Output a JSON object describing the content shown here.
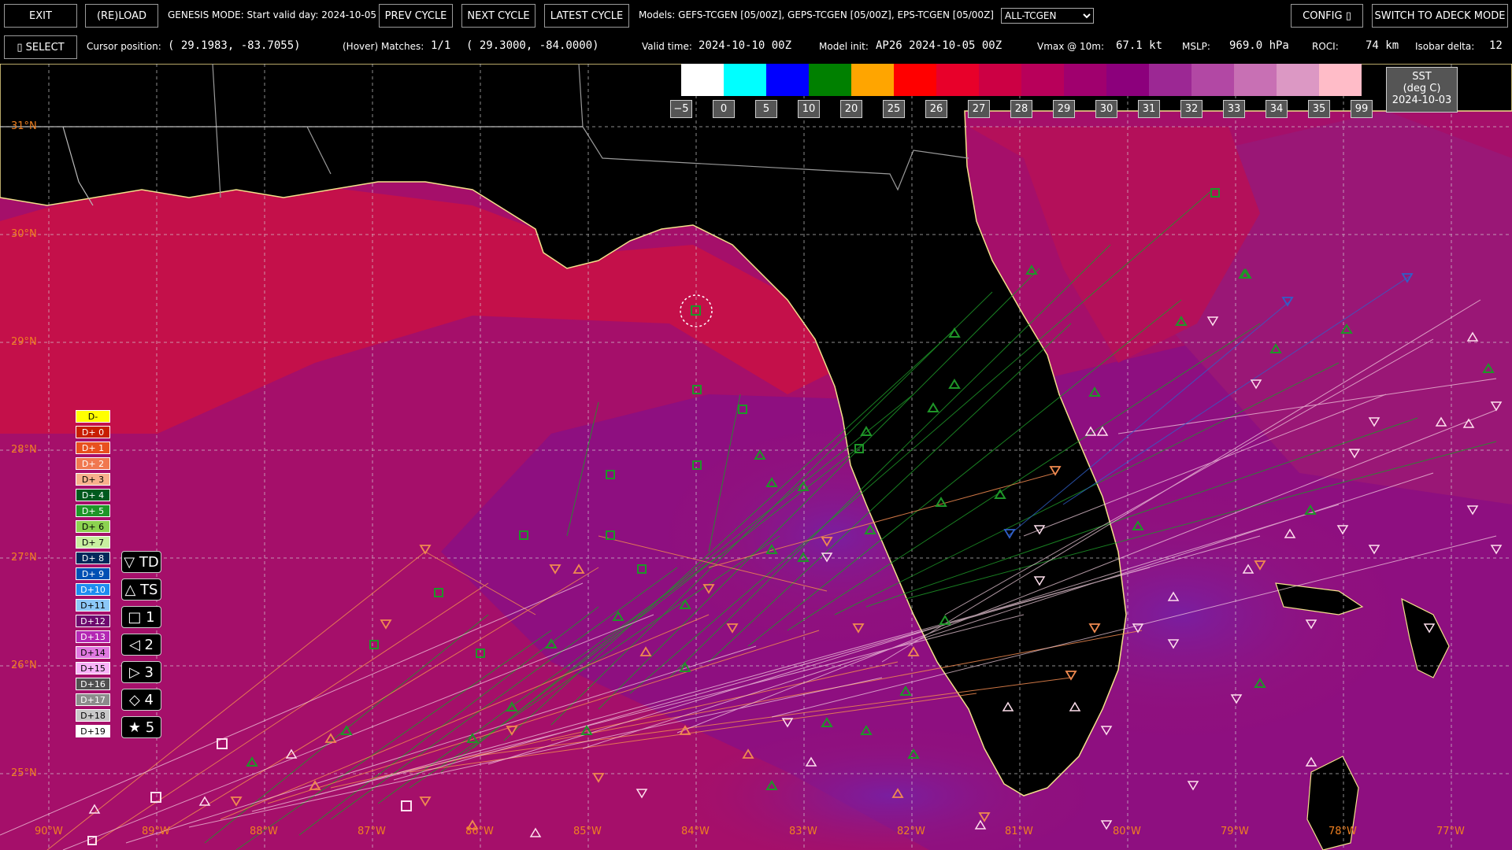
{
  "toolbar": {
    "exit_label": "EXIT",
    "reload_label": "(RE)LOAD",
    "genesis_text": "GENESIS MODE: Start valid day: 2024-10-05",
    "prev_cycle_label": "PREV CYCLE",
    "next_cycle_label": "NEXT CYCLE",
    "latest_cycle_label": "LATEST CYCLE",
    "models_text": "Models: GEFS-TCGEN [05/00Z], GEPS-TCGEN [05/00Z], EPS-TCGEN [05/00Z]",
    "model_select": "ALL-TCGEN",
    "config_label": "CONFIG ▯",
    "switch_label": "SWITCH TO ADECK MODE"
  },
  "status": {
    "select_label": "▯ SELECT",
    "cursor_label": "Cursor position:",
    "cursor_value": "( 29.1983,  -83.7055)",
    "hover_label": "(Hover) Matches:",
    "hover_count": "1/1",
    "hover_value": "( 29.3000,  -84.0000)",
    "valid_label": "Valid time:",
    "valid_value": "2024-10-10 00Z",
    "model_label": "Model init:",
    "model_value": "AP26 2024-10-05 00Z",
    "vmax_label": "Vmax @ 10m:",
    "vmax_value": "67.1 kt",
    "mslp_label": "MSLP:",
    "mslp_value": "969.0 hPa",
    "roci_label": "ROCI:",
    "roci_value": "74 km",
    "isobar_label": "Isobar delta:",
    "isobar_value": "12"
  },
  "colorbar": {
    "title_line1": "SST",
    "title_line2": "(deg C)",
    "title_line3": "2024-10-03",
    "colors": [
      "#ffffff",
      "#00ffff",
      "#0000ff",
      "#008000",
      "#ffa500",
      "#ff0000",
      "#e8002a",
      "#cc0044",
      "#b8005a",
      "#a0006e",
      "#8c007c",
      "#9c2894",
      "#b248a4",
      "#c870b4",
      "#dc98c4",
      "#ffbcc8"
    ],
    "ticks": [
      "−5",
      "0",
      "5",
      "10",
      "20",
      "25",
      "26",
      "27",
      "28",
      "29",
      "30",
      "31",
      "32",
      "33",
      "34",
      "35",
      "99"
    ]
  },
  "map": {
    "lat_labels": [
      "31°N",
      "30°N",
      "29°N",
      "28°N",
      "27°N",
      "26°N",
      "25°N"
    ],
    "lon_labels": [
      "90°W",
      "89°W",
      "88°W",
      "87°W",
      "86°W",
      "85°W",
      "84°W",
      "83°W",
      "82°W",
      "81°W",
      "80°W",
      "79°W",
      "78°W",
      "77°W"
    ]
  },
  "legend": {
    "days": [
      {
        "label": "D-",
        "bg": "#ffff00",
        "fg": "#000000"
      },
      {
        "label": "D+ 0",
        "bg": "#c81e00",
        "fg": "#ffffff"
      },
      {
        "label": "D+ 1",
        "bg": "#e8501e",
        "fg": "#ffffff"
      },
      {
        "label": "D+ 2",
        "bg": "#f07850",
        "fg": "#ffffff"
      },
      {
        "label": "D+ 3",
        "bg": "#f8b08c",
        "fg": "#000000"
      },
      {
        "label": "D+ 4",
        "bg": "#005a1e",
        "fg": "#ffffff"
      },
      {
        "label": "D+ 5",
        "bg": "#1e9628",
        "fg": "#ffffff"
      },
      {
        "label": "D+ 6",
        "bg": "#8cd250",
        "fg": "#000000"
      },
      {
        "label": "D+ 7",
        "bg": "#c8f0a0",
        "fg": "#000000"
      },
      {
        "label": "D+ 8",
        "bg": "#00285a",
        "fg": "#ffffff"
      },
      {
        "label": "D+ 9",
        "bg": "#0050b4",
        "fg": "#ffffff"
      },
      {
        "label": "D+10",
        "bg": "#1e8cf0",
        "fg": "#ffffff"
      },
      {
        "label": "D+11",
        "bg": "#8cc8f8",
        "fg": "#000000"
      },
      {
        "label": "D+12",
        "bg": "#6e0a6e",
        "fg": "#ffffff"
      },
      {
        "label": "D+13",
        "bg": "#b428b4",
        "fg": "#ffffff"
      },
      {
        "label": "D+14",
        "bg": "#e078e0",
        "fg": "#000000"
      },
      {
        "label": "D+15",
        "bg": "#f8b4f8",
        "fg": "#000000"
      },
      {
        "label": "D+16",
        "bg": "#505050",
        "fg": "#ffffff"
      },
      {
        "label": "D+17",
        "bg": "#8c8c8c",
        "fg": "#ffffff"
      },
      {
        "label": "D+18",
        "bg": "#c8c8c8",
        "fg": "#000000"
      },
      {
        "label": "D+19",
        "bg": "#ffffff",
        "fg": "#000000"
      }
    ],
    "markers": [
      {
        "label": "▽ TD"
      },
      {
        "label": "△ TS"
      },
      {
        "label": "□ 1"
      },
      {
        "label": "◁ 2"
      },
      {
        "label": "▷ 3"
      },
      {
        "label": "◇ 4"
      },
      {
        "label": "★ 5"
      }
    ]
  }
}
